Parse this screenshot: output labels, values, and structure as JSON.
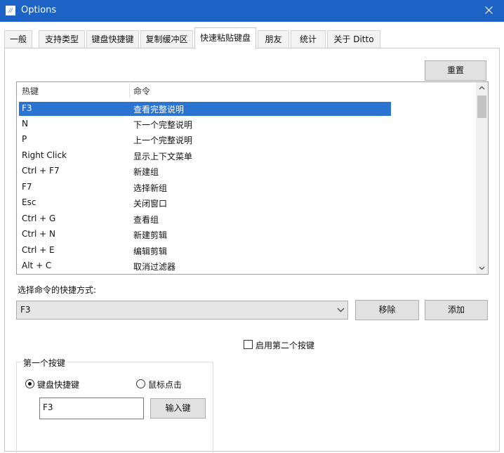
{
  "window": {
    "title": "Options",
    "icon": "ditto-app-icon",
    "close_icon": "close-icon"
  },
  "tabs": [
    {
      "label": "一般",
      "active": false
    },
    {
      "label": "支持类型",
      "active": false
    },
    {
      "label": "键盘快捷键",
      "active": false
    },
    {
      "label": "复制缓冲区",
      "active": false
    },
    {
      "label": "快速粘贴键盘",
      "active": true
    },
    {
      "label": "朋友",
      "active": false
    },
    {
      "label": "统计",
      "active": false
    },
    {
      "label": "关于 Ditto",
      "active": false
    }
  ],
  "reset_button": "重置",
  "shortcut_list": {
    "columns": [
      "热键",
      "命令"
    ],
    "rows": [
      {
        "key": "F3",
        "command": "查看完整说明",
        "selected": true
      },
      {
        "key": "N",
        "command": "下一个完整说明",
        "selected": false
      },
      {
        "key": "P",
        "command": "上一个完整说明",
        "selected": false
      },
      {
        "key": "Right Click",
        "command": "显示上下文菜单",
        "selected": false
      },
      {
        "key": "Ctrl + F7",
        "command": "新建组",
        "selected": false
      },
      {
        "key": "F7",
        "command": "选择新组",
        "selected": false
      },
      {
        "key": "Esc",
        "command": "关闭窗口",
        "selected": false
      },
      {
        "key": "Ctrl + G",
        "command": "查看组",
        "selected": false
      },
      {
        "key": "Ctrl + N",
        "command": "新建剪辑",
        "selected": false
      },
      {
        "key": "Ctrl + E",
        "command": "编辑剪辑",
        "selected": false
      },
      {
        "key": "Alt + C",
        "command": "取消过滤器",
        "selected": false
      }
    ],
    "selected_color": "#2b73d0"
  },
  "select_shortcut_label": "选择命令的快捷方式:",
  "shortcut_combo_value": "F3",
  "remove_button": "移除",
  "add_button": "添加",
  "enable_second_key_label": "启用第二个按键",
  "first_key_group": {
    "title": "第一个按键",
    "keyboard_radio_label": "键盘快捷键",
    "mouse_radio_label": "鼠标点击",
    "key_value": "F3",
    "enter_key_button": "输入键"
  }
}
